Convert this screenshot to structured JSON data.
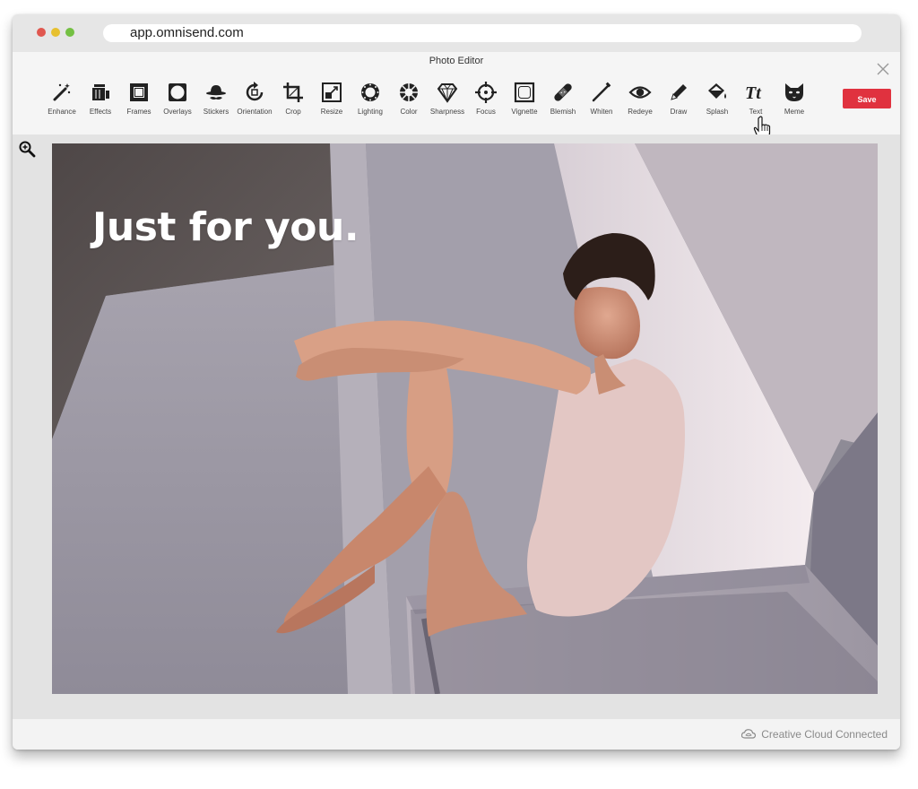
{
  "browser": {
    "url": "app.omnisend.com"
  },
  "editor": {
    "title": "Photo Editor",
    "save_label": "Save",
    "tools": [
      {
        "label": "Enhance",
        "icon": "magic-wand-icon"
      },
      {
        "label": "Effects",
        "icon": "effects-icon"
      },
      {
        "label": "Frames",
        "icon": "frame-icon"
      },
      {
        "label": "Overlays",
        "icon": "overlay-icon"
      },
      {
        "label": "Stickers",
        "icon": "sticker-hat-icon"
      },
      {
        "label": "Orientation",
        "icon": "rotate-icon"
      },
      {
        "label": "Crop",
        "icon": "crop-icon"
      },
      {
        "label": "Resize",
        "icon": "resize-icon"
      },
      {
        "label": "Lighting",
        "icon": "sun-icon"
      },
      {
        "label": "Color",
        "icon": "color-wheel-icon"
      },
      {
        "label": "Sharpness",
        "icon": "diamond-icon"
      },
      {
        "label": "Focus",
        "icon": "crosshair-icon"
      },
      {
        "label": "Vignette",
        "icon": "vignette-icon"
      },
      {
        "label": "Blemish",
        "icon": "bandage-icon"
      },
      {
        "label": "Whiten",
        "icon": "whiten-brush-icon"
      },
      {
        "label": "Redeye",
        "icon": "eye-icon"
      },
      {
        "label": "Draw",
        "icon": "pencil-icon"
      },
      {
        "label": "Splash",
        "icon": "paint-bucket-icon"
      },
      {
        "label": "Text",
        "icon": "text-icon"
      },
      {
        "label": "Meme",
        "icon": "cat-face-icon"
      }
    ]
  },
  "photo": {
    "overlay_text": "Just for you."
  },
  "footer": {
    "status": "Creative Cloud Connected"
  },
  "colors": {
    "save_button": "#e0323f",
    "toolbar_bg": "#f5f5f5",
    "canvas_bg": "#e3e3e3"
  }
}
